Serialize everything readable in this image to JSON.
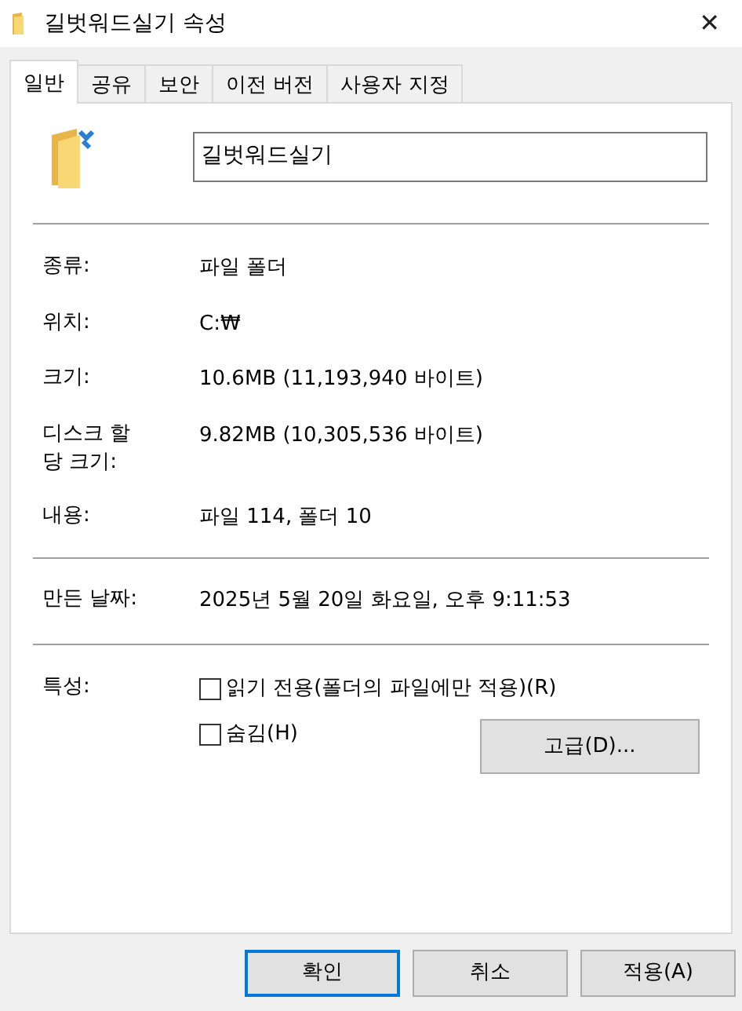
{
  "window": {
    "title": "길벗워드실기 속성",
    "close": "✕"
  },
  "tabs": [
    {
      "label": "일반",
      "selected": true
    },
    {
      "label": "공유",
      "selected": false
    },
    {
      "label": "보안",
      "selected": false
    },
    {
      "label": "이전 버전",
      "selected": false
    },
    {
      "label": "사용자 지정",
      "selected": false
    }
  ],
  "name_field": {
    "value": "길벗워드실기"
  },
  "groups": [
    [
      {
        "label": "종류:",
        "value": "파일 폴더"
      },
      {
        "label": "위치:",
        "value": "C:₩"
      },
      {
        "label": "크기:",
        "value": "10.6MB (11,193,940 바이트)"
      },
      {
        "label": "디스크 할\n당 크기:",
        "value": "9.82MB (10,305,536 바이트)"
      },
      {
        "label": "내용:",
        "value": "파일 114, 폴더 10"
      }
    ],
    [
      {
        "label": "만든 날짜:",
        "value": "2025년 5월 20일 화요일, 오후 9:11:53"
      }
    ]
  ],
  "attributes": {
    "label": "특성:",
    "options": [
      {
        "label": "읽기 전용(폴더의 파일에만 적용)(R)",
        "checked": false
      },
      {
        "label": "숨김(H)",
        "checked": false
      }
    ],
    "advanced_button": "고급(D)..."
  },
  "buttons": [
    {
      "label": "확인",
      "default": true
    },
    {
      "label": "취소",
      "default": false
    },
    {
      "label": "적용(A)",
      "default": false
    }
  ]
}
